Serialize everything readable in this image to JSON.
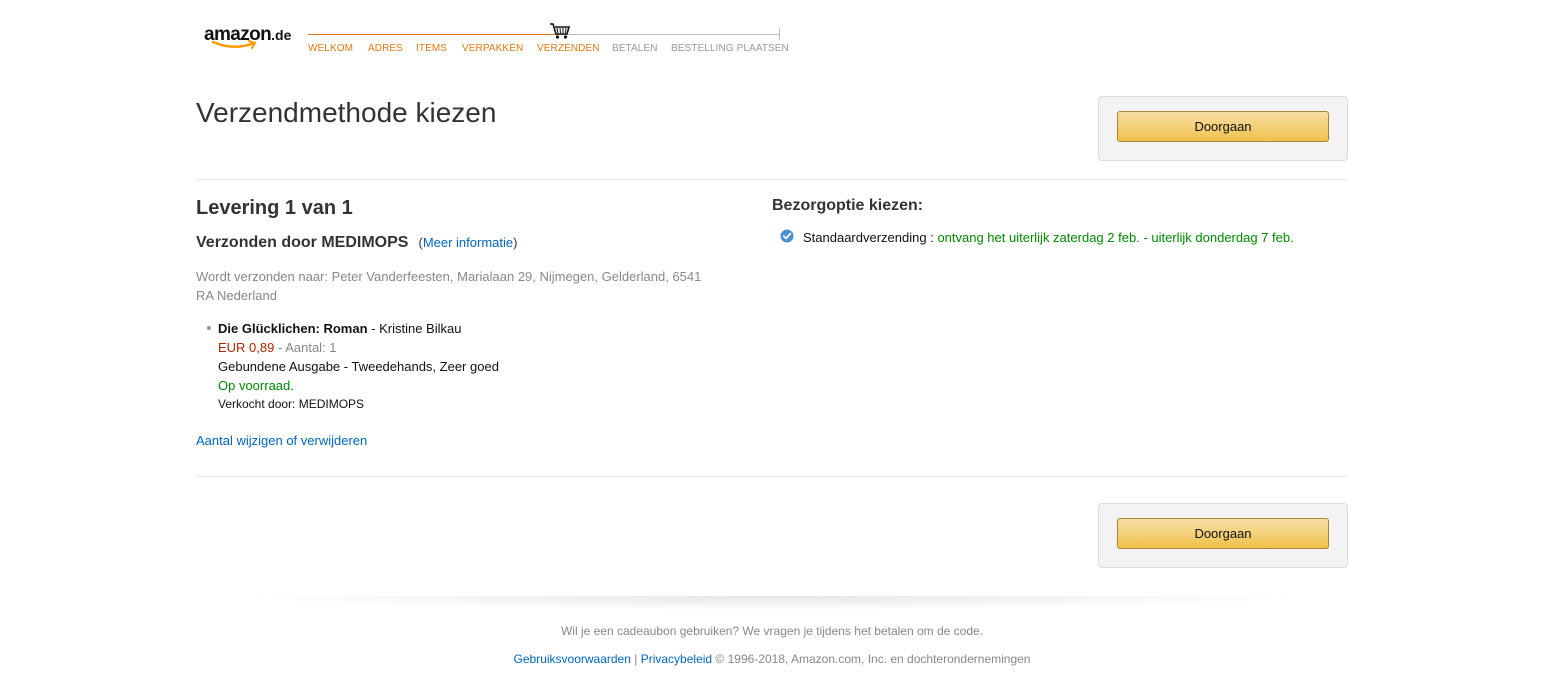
{
  "header": {
    "logo_text": "amazon",
    "logo_tld": ".de",
    "steps": [
      {
        "label": "WELKOM",
        "state": "done"
      },
      {
        "label": "ADRES",
        "state": "done"
      },
      {
        "label": "ITEMS",
        "state": "done"
      },
      {
        "label": "VERPAKKEN",
        "state": "done"
      },
      {
        "label": "VERZENDEN",
        "state": "current"
      },
      {
        "label": "BETALEN",
        "state": "todo"
      },
      {
        "label": "BESTELLING PLAATSEN",
        "state": "todo"
      }
    ],
    "accent_color": "#e47911"
  },
  "page": {
    "title": "Verzendmethode kiezen",
    "continue_label": "Doorgaan"
  },
  "delivery": {
    "heading": "Levering 1 van 1",
    "shipped_by": "Verzonden door MEDIMOPS",
    "more_info_open": "(",
    "more_info_link": "Meer informatie",
    "more_info_close": ")",
    "ship_to": "Wordt verzonden naar: Peter Vanderfeesten, Marialaan 29, Nijmegen, Gelderland, 6541 RA Nederland",
    "item": {
      "title": "Die Glücklichen: Roman",
      "author": " - Kristine Bilkau",
      "price": "EUR 0,89",
      "quantity": " - Aantal: 1",
      "format": "Gebundene Ausgabe - Tweedehands, Zeer goed",
      "stock": "Op voorraad.",
      "sold_by": "Verkocht door: MEDIMOPS"
    },
    "change_link": "Aantal wijzigen of verwijderen"
  },
  "shipping_option": {
    "heading": "Bezorgoptie kiezen:",
    "name": "Standaardverzending",
    "separator": " : ",
    "eta": "ontvang het uiterlijk zaterdag 2 feb. - uiterlijk donderdag 7 feb.",
    "selected": true
  },
  "footer": {
    "gift_note": "Wil je een cadeaubon gebruiken? We vragen je tijdens het betalen om de code.",
    "terms_link": "Gebruiksvoorwaarden",
    "sep": " | ",
    "privacy_link": "Privacybeleid",
    "copyright": " © 1996-2018, Amazon.com, Inc. en dochterondernemingen"
  }
}
